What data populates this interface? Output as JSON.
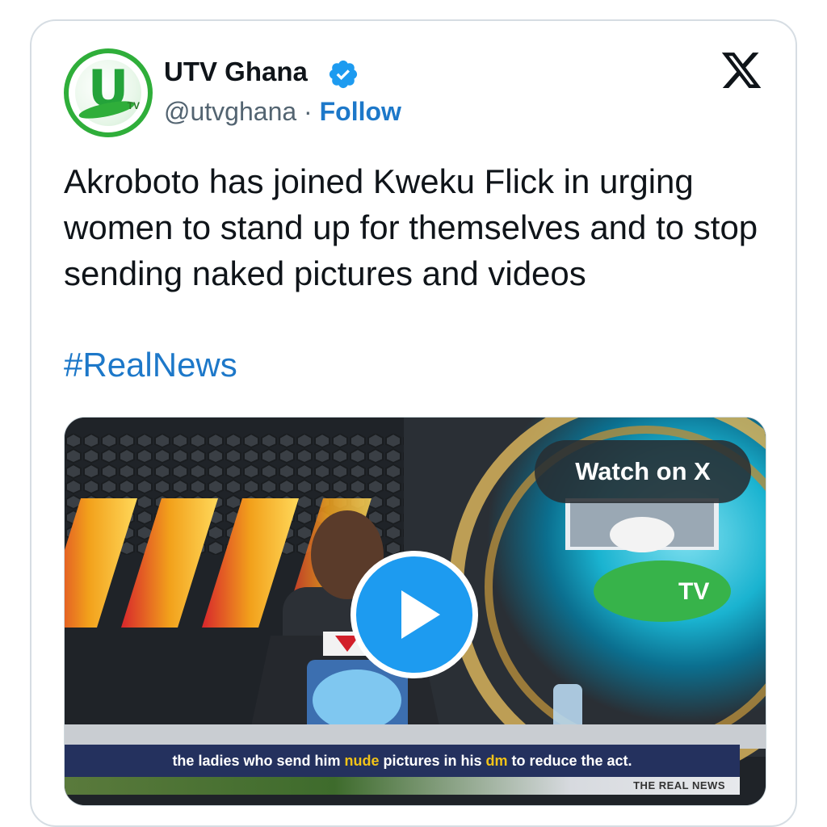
{
  "account": {
    "name": "UTV Ghana",
    "handle": "@utvghana",
    "separator": "·",
    "follow_label": "Follow",
    "avatar_icon": "utv-ghana-logo",
    "verified_icon": "verified-badge-icon"
  },
  "platform_icon": "x-logo-icon",
  "tweet": {
    "text": "Akroboto has joined Kweku Flick in urging women to stand up for themselves and to stop sending naked pictures and videos",
    "hashtag": "#RealNews"
  },
  "media": {
    "watch_label": "Watch on X",
    "play_icon": "play-icon",
    "caption_before": "the ladies who send him ",
    "caption_hl1": "nude",
    "caption_mid": " pictures in his ",
    "caption_hl2": "dm",
    "caption_after": " to reduce the act.",
    "news_tag": "THE REAL NEWS"
  },
  "colors": {
    "link": "#1d78c9",
    "play_button": "#1d9bf0",
    "brand_green": "#2fae3a"
  }
}
